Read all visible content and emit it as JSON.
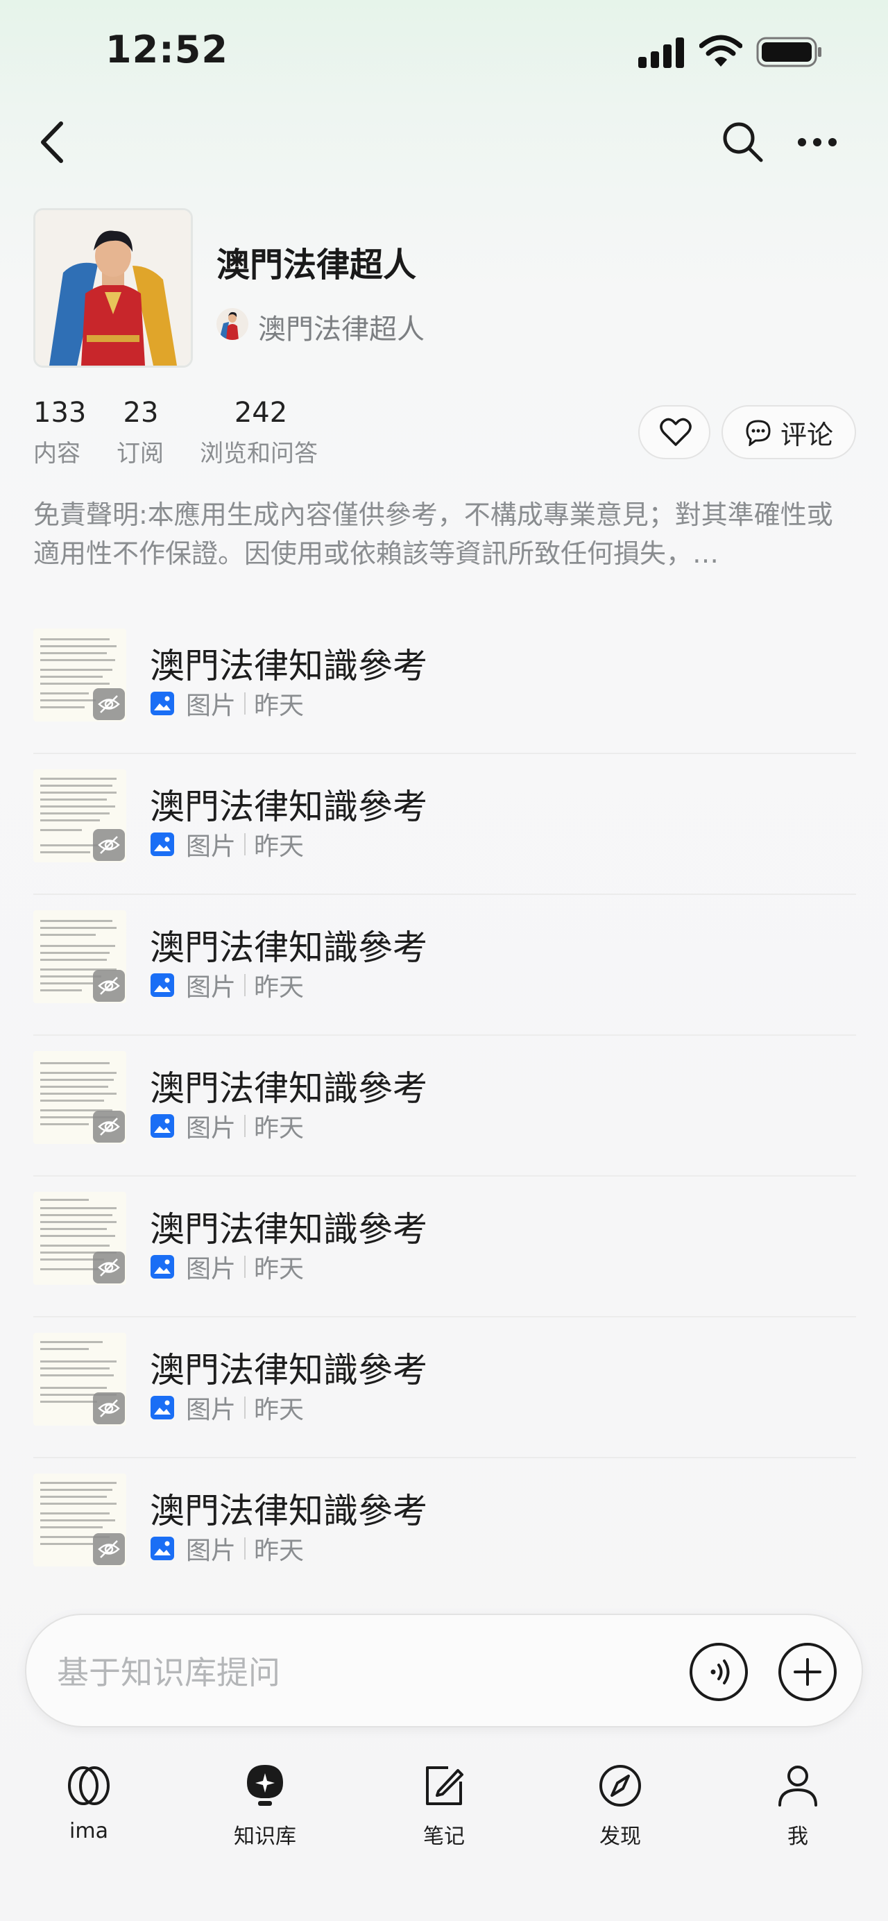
{
  "status_bar": {
    "time": "12:52"
  },
  "nav": {
    "back_icon": "chevron-left-icon",
    "search_icon": "search-icon",
    "more_icon": "more-icon"
  },
  "profile": {
    "title": "澳門法律超人",
    "owner_name": "澳門法律超人",
    "stats": [
      {
        "value": "133",
        "label": "内容"
      },
      {
        "value": "23",
        "label": "订阅"
      },
      {
        "value": "242",
        "label": "浏览和问答"
      }
    ],
    "comment_label": "评论",
    "disclaimer": "免責聲明:本應用生成內容僅供參考，不構成專業意見；對其準確性或適用性不作保證。因使用或依賴該等資訊所致任何損失，…"
  },
  "items": [
    {
      "title": "澳門法律知識參考",
      "type": "图片",
      "time": "昨天"
    },
    {
      "title": "澳門法律知識參考",
      "type": "图片",
      "time": "昨天"
    },
    {
      "title": "澳門法律知識參考",
      "type": "图片",
      "time": "昨天"
    },
    {
      "title": "澳門法律知識參考",
      "type": "图片",
      "time": "昨天"
    },
    {
      "title": "澳門法律知識參考",
      "type": "图片",
      "time": "昨天"
    },
    {
      "title": "澳門法律知識參考",
      "type": "图片",
      "time": "昨天"
    },
    {
      "title": "澳門法律知識參考",
      "type": "图片",
      "time": "昨天"
    }
  ],
  "ask_bar": {
    "placeholder": "基于知识库提问"
  },
  "tabs": [
    {
      "label": "ima",
      "icon": "ima-logo-icon"
    },
    {
      "label": "知识库",
      "icon": "knowledge-base-icon"
    },
    {
      "label": "笔记",
      "icon": "note-icon"
    },
    {
      "label": "发现",
      "icon": "compass-icon"
    },
    {
      "label": "我",
      "icon": "user-icon"
    }
  ],
  "colors": {
    "accent_blue": "#1a6ef5",
    "text_gray": "#8a8d90"
  }
}
